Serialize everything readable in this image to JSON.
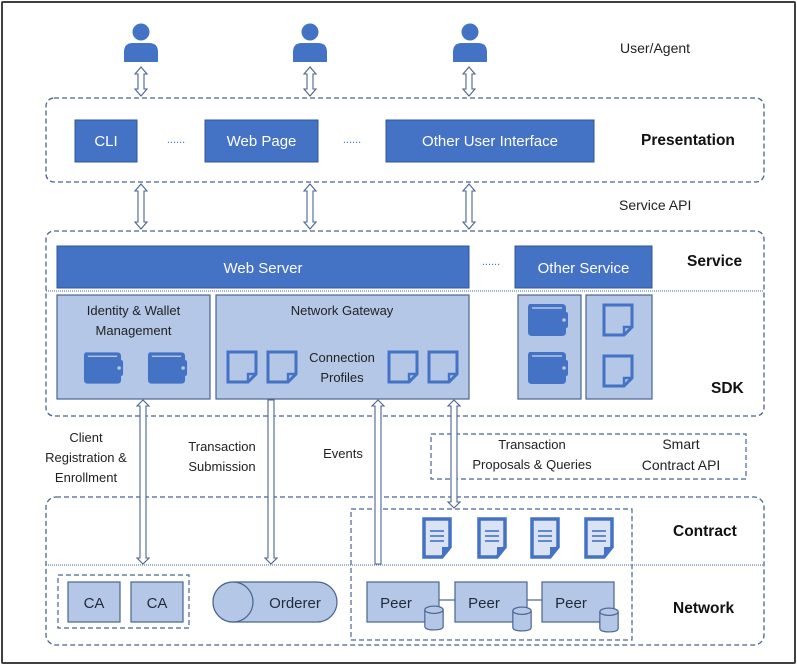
{
  "colors": {
    "primary_blue": "#4472c4",
    "light_blue_fill": "#b4c7e7",
    "border_blue": "#2f5597",
    "dashed_line": "#4a6490",
    "doc_fill": "#dae3f3",
    "text_dark": "#222222"
  },
  "user_agent": {
    "label": "User/Agent",
    "icons": [
      "user-icon",
      "user-icon",
      "user-icon"
    ]
  },
  "presentation": {
    "layer_label": "Presentation",
    "items": [
      {
        "label": "CLI"
      },
      {
        "label": "Web Page"
      },
      {
        "label": "Other User Interface"
      }
    ],
    "ellipsis": "......"
  },
  "service_api_label": "Service API",
  "service": {
    "layer_label": "Service",
    "web_server": "Web Server",
    "other_service": "Other Service",
    "ellipsis": "......"
  },
  "sdk": {
    "layer_label": "SDK",
    "identity_wallet": {
      "title_line1": "Identity & Wallet",
      "title_line2": "Management",
      "icons": [
        "wallet-icon",
        "wallet-icon"
      ]
    },
    "network_gateway": {
      "title": "Network Gateway",
      "profiles_line1": "Connection",
      "profiles_line2": "Profiles",
      "icons": [
        "document-icon",
        "document-icon",
        "document-icon",
        "document-icon"
      ]
    },
    "other_sdk": {
      "icons": [
        "wallet-icon",
        "wallet-icon",
        "document-icon",
        "document-icon"
      ]
    }
  },
  "flows": {
    "client_registration": [
      "Client",
      "Registration &",
      "Enrollment"
    ],
    "transaction_submission": [
      "Transaction",
      "Submission"
    ],
    "events": "Events",
    "transaction_proposals": [
      "Transaction",
      "Proposals & Queries"
    ],
    "smart_contract_api": [
      "Smart",
      "Contract API"
    ]
  },
  "contract": {
    "layer_label": "Contract",
    "icons": [
      "contract-document-icon",
      "contract-document-icon",
      "contract-document-icon",
      "contract-document-icon"
    ]
  },
  "network": {
    "layer_label": "Network",
    "cas": [
      "CA",
      "CA"
    ],
    "orderer": "Orderer",
    "peers": [
      "Peer",
      "Peer",
      "Peer"
    ]
  }
}
